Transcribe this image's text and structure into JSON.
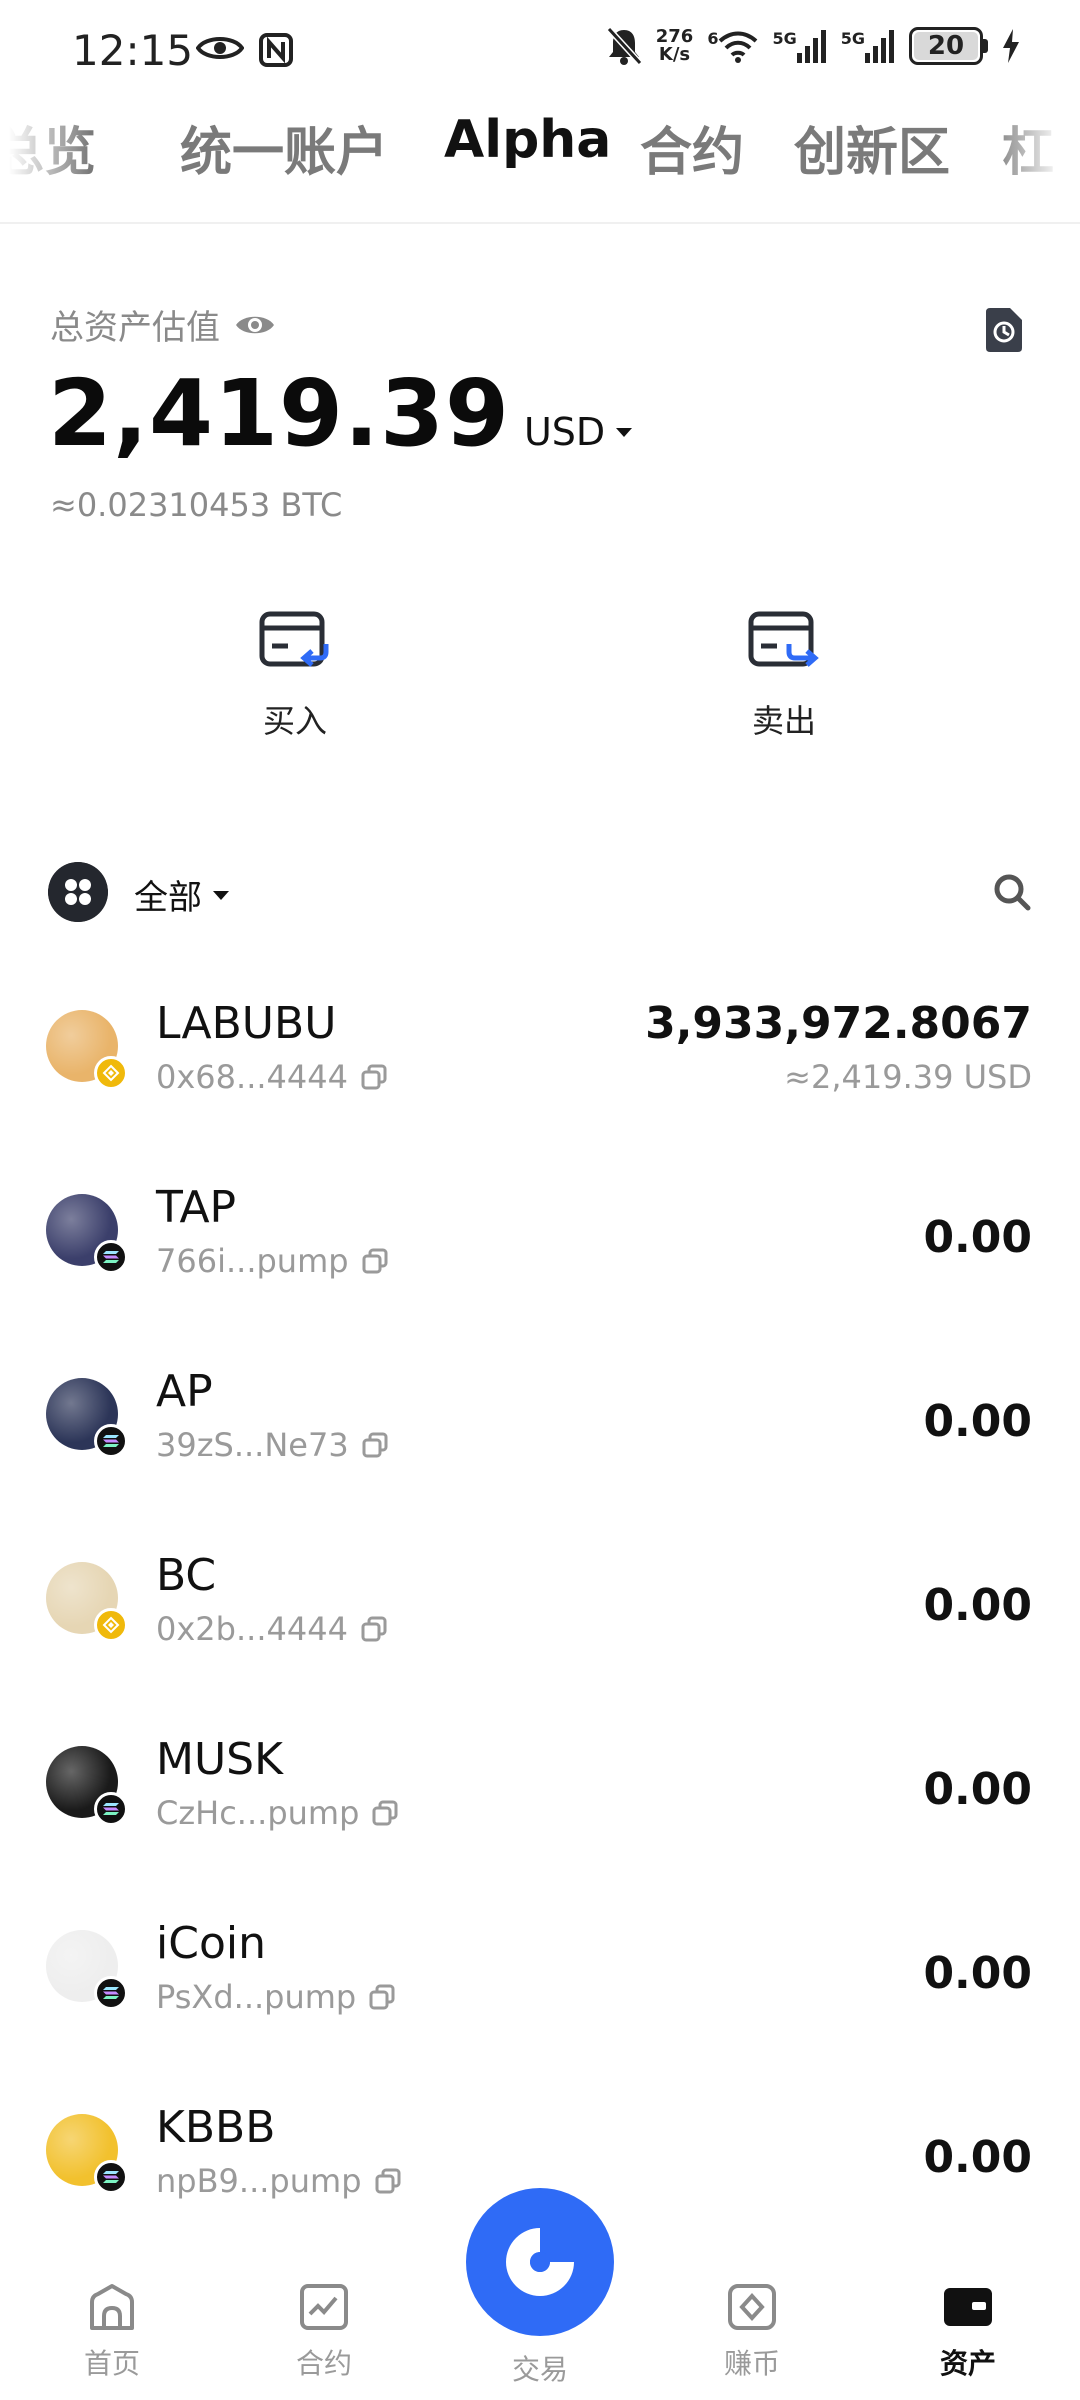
{
  "status_bar": {
    "time": "12:15",
    "net_speed_value": "276",
    "net_speed_unit": "K/s",
    "wifi_sup": "6",
    "signal1": "5G",
    "signal2": "5G",
    "battery": "20"
  },
  "tabs": [
    {
      "label": "总览"
    },
    {
      "label": "统一账户"
    },
    {
      "label": "Alpha",
      "active": true
    },
    {
      "label": "合约"
    },
    {
      "label": "创新区"
    },
    {
      "label": "杠"
    }
  ],
  "assets": {
    "label": "总资产估值",
    "value": "2,419.39",
    "currency": "USD",
    "btc": "≈0.02310453 BTC"
  },
  "actions": {
    "buy": "买入",
    "sell": "卖出"
  },
  "filter": {
    "label": "全部"
  },
  "tokens": [
    {
      "symbol": "LABUBU",
      "address": "0x68...4444",
      "amount": "3,933,972.8067",
      "usd": "≈2,419.39 USD",
      "chain": "bsc",
      "color": "#e9b46a"
    },
    {
      "symbol": "TAP",
      "address": "766i...pump",
      "amount": "0.00",
      "chain": "sol",
      "color": "#3b3f6b"
    },
    {
      "symbol": "AP",
      "address": "39zS...Ne73",
      "amount": "0.00",
      "chain": "sol",
      "color": "#2c3558"
    },
    {
      "symbol": "BC",
      "address": "0x2b...4444",
      "amount": "0.00",
      "chain": "bsc",
      "color": "#e6d6b4"
    },
    {
      "symbol": "MUSK",
      "address": "CzHc...pump",
      "amount": "0.00",
      "chain": "sol",
      "color": "#1a1a1a"
    },
    {
      "symbol": "iCoin",
      "address": "PsXd...pump",
      "amount": "0.00",
      "chain": "sol",
      "color": "#eeeeee"
    },
    {
      "symbol": "KBBB",
      "address": "npB9...pump",
      "amount": "0.00",
      "chain": "sol",
      "color": "#f2c12e"
    }
  ],
  "nav": {
    "home": "首页",
    "futures": "合约",
    "trade": "交易",
    "earn": "赚币",
    "assets": "资产"
  },
  "colors": {
    "accent": "#2F6BF6",
    "bsc": "#F0B90B"
  }
}
